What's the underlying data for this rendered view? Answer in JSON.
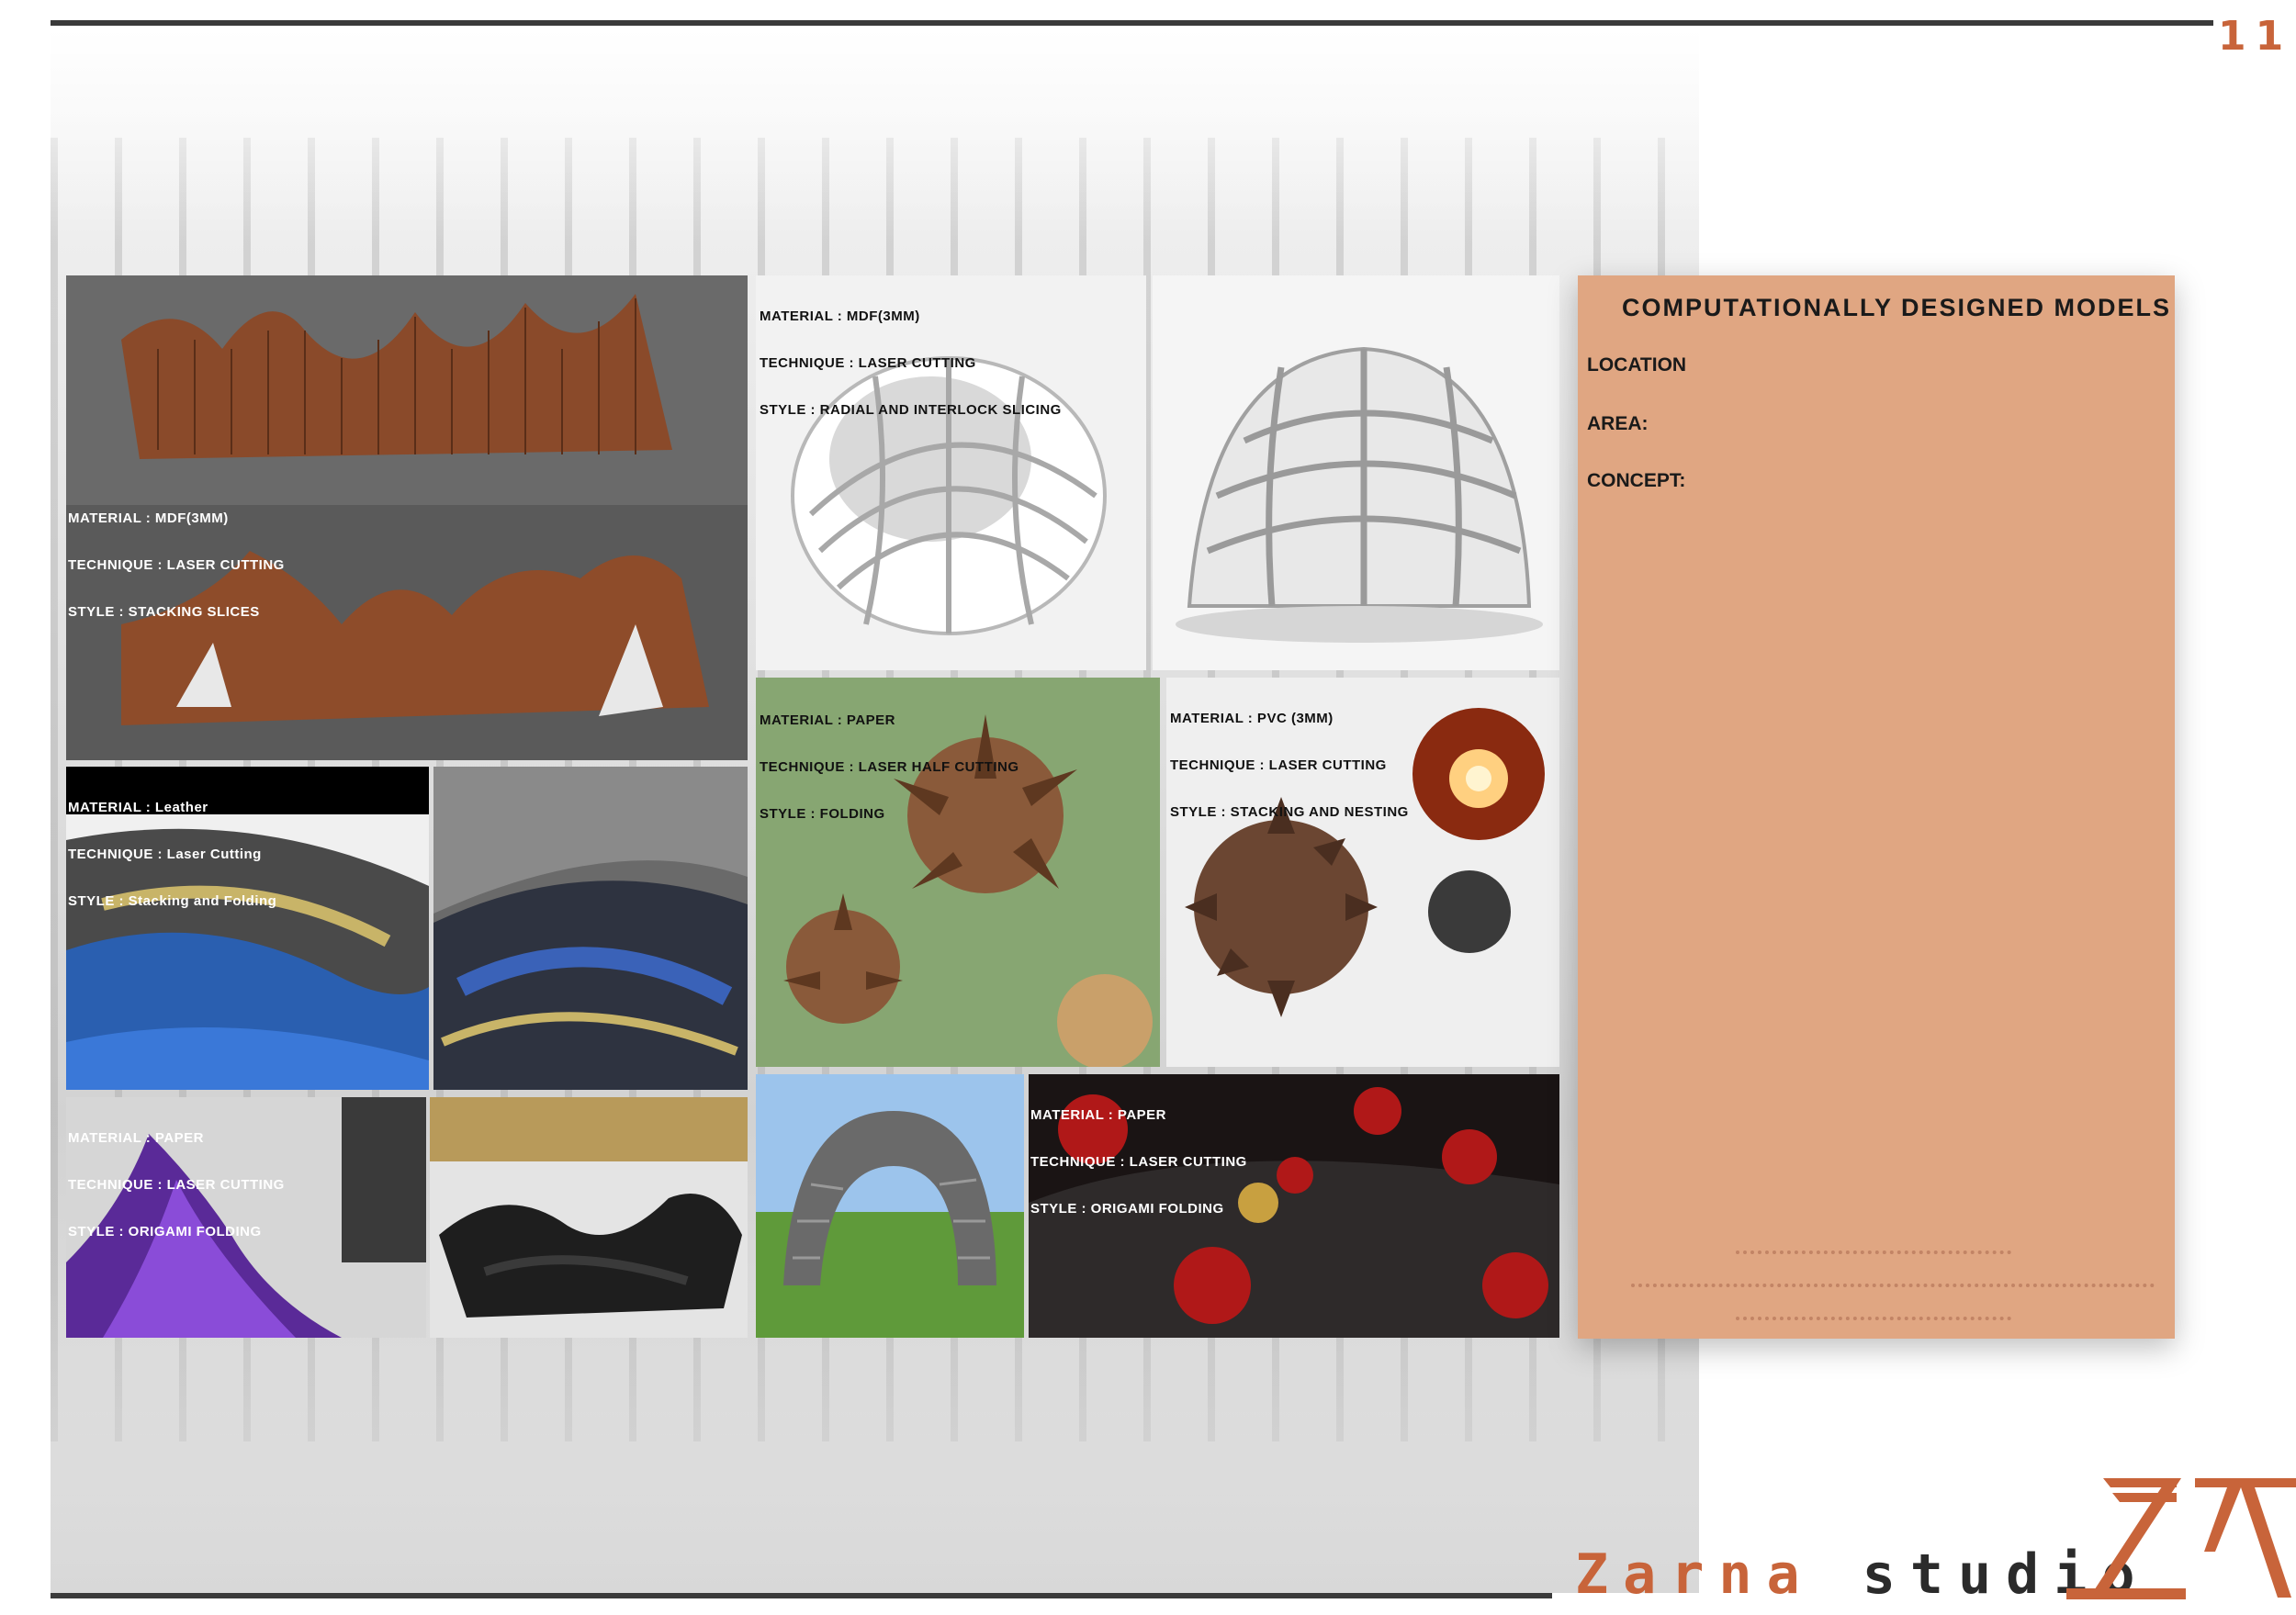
{
  "page": {
    "number": "11"
  },
  "captions": {
    "wood_seating": [
      "MATERIAL : MDF(3MM)",
      "TECHNIQUE : LASER CUTTING",
      "STYLE : STACKING SLICES"
    ],
    "dome_radial": [
      "MATERIAL : MDF(3MM)",
      "TECHNIQUE : LASER CUTTING",
      "STYLE : RADIAL AND INTERLOCK SLICING"
    ],
    "leather_wave": [
      "MATERIAL : Leather",
      "TECHNIQUE : Laser Cutting",
      "STYLE : Stacking and Folding"
    ],
    "paper_folding": [
      "MATERIAL : PAPER",
      "TECHNIQUE : LASER HALF CUTTING",
      "STYLE : FOLDING"
    ],
    "pvc_stacking": [
      "MATERIAL : PVC (3MM)",
      "TECHNIQUE : LASER CUTTING",
      "STYLE : STACKING AND NESTING"
    ],
    "paper_origami": [
      "MATERIAL : PAPER",
      "TECHNIQUE : LASER CUTTING",
      "STYLE : ORIGAMI FOLDING"
    ],
    "paper_red": [
      "MATERIAL : PAPER",
      "TECHNIQUE : LASER CUTTING",
      "STYLE : ORIGAMI FOLDING"
    ]
  },
  "panel": {
    "title": "COMPUTATIONALLY DESIGNED MODELS",
    "location_label": "LOCATION",
    "area_label": "AREA:",
    "concept_label": "CONCEPT:"
  },
  "brand": {
    "part1": "Zarna",
    "part2": "studio"
  },
  "colors": {
    "accent": "#c8643a",
    "panel": "#e0a682",
    "rule": "#3a3a3a"
  }
}
